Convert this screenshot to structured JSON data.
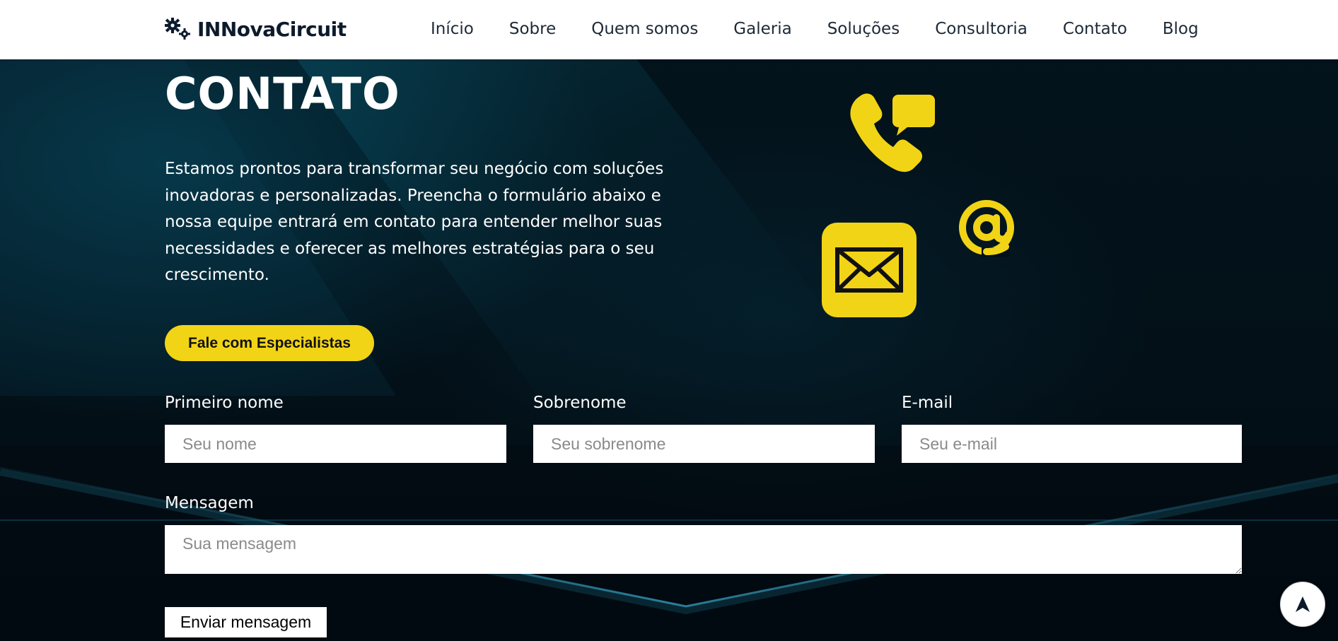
{
  "brand": {
    "name": "INNovaCircuit",
    "logo_icon": "gears-icon"
  },
  "nav": {
    "items": [
      "Início",
      "Sobre",
      "Quem somos",
      "Galeria",
      "Soluções",
      "Consultoria",
      "Contato",
      "Blog"
    ]
  },
  "hero": {
    "title": "CONTATO",
    "intro": "Estamos prontos para transformar seu negócio com soluções inovadoras e personalizadas. Preencha o formulário abaixo e nossa equipe entrará em contato para entender melhor suas necessidades e oferecer as melhores estratégias para o seu crescimento.",
    "cta_label": "Fale com Especialistas",
    "icons": [
      "phone-chat-icon",
      "at-sign-icon",
      "envelope-icon"
    ]
  },
  "form": {
    "first_name": {
      "label": "Primeiro nome",
      "placeholder": "Seu nome"
    },
    "last_name": {
      "label": "Sobrenome",
      "placeholder": "Seu sobrenome"
    },
    "email": {
      "label": "E-mail",
      "placeholder": "Seu e-mail"
    },
    "message": {
      "label": "Mensagem",
      "placeholder": "Sua mensagem"
    },
    "submit_label": "Enviar mensagem"
  },
  "scroll_top": {
    "icon": "arrow-up-icon"
  },
  "colors": {
    "accent": "#f2d417",
    "background": "#02070b",
    "header_bg": "#ffffff",
    "text_light": "#ffffff",
    "nav_text": "#1d2a38"
  }
}
